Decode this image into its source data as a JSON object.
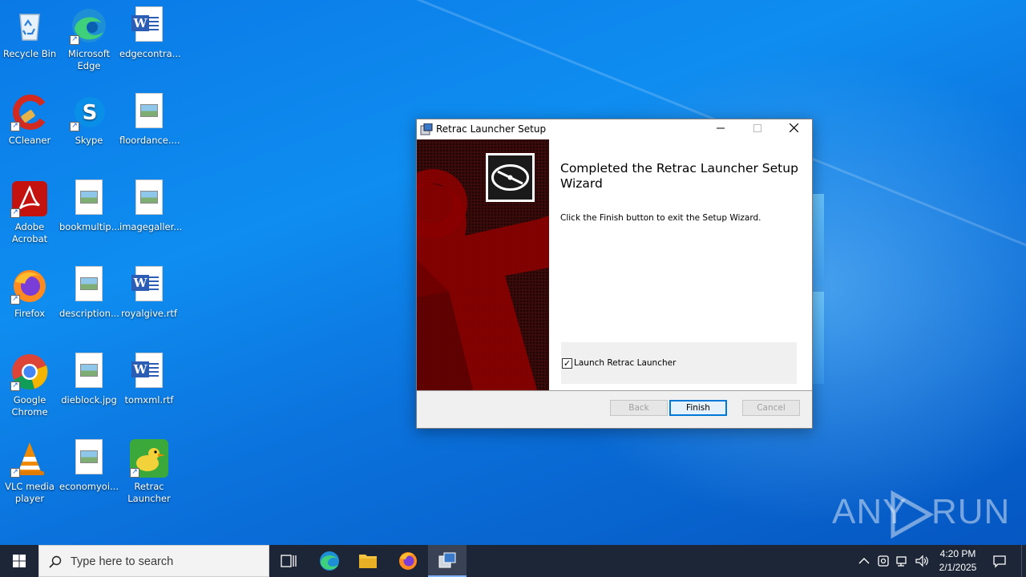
{
  "desktop": {
    "icons": [
      {
        "label": "Recycle Bin",
        "icon": "recycle-bin-icon"
      },
      {
        "label": "Microsoft Edge",
        "icon": "edge-icon"
      },
      {
        "label": "edgecontra...",
        "icon": "word-document-icon"
      },
      {
        "label": "CCleaner",
        "icon": "ccleaner-icon"
      },
      {
        "label": "Skype",
        "icon": "skype-icon"
      },
      {
        "label": "floordance....",
        "icon": "image-file-icon"
      },
      {
        "label": "Adobe Acrobat",
        "icon": "acrobat-icon"
      },
      {
        "label": "bookmultip...",
        "icon": "image-file-icon"
      },
      {
        "label": "imagegaller...",
        "icon": "image-file-icon"
      },
      {
        "label": "Firefox",
        "icon": "firefox-icon"
      },
      {
        "label": "description...",
        "icon": "image-file-icon"
      },
      {
        "label": "royalgive.rtf",
        "icon": "word-document-icon"
      },
      {
        "label": "Google Chrome",
        "icon": "chrome-icon"
      },
      {
        "label": "dieblock.jpg",
        "icon": "image-file-icon"
      },
      {
        "label": "tomxml.rtf",
        "icon": "word-document-icon"
      },
      {
        "label": "VLC media player",
        "icon": "vlc-icon"
      },
      {
        "label": "economyoi...",
        "icon": "image-file-icon"
      },
      {
        "label": "Retrac Launcher",
        "icon": "retrac-launcher-icon"
      }
    ]
  },
  "dialog": {
    "title": "Retrac Launcher Setup",
    "heading": "Completed the Retrac Launcher Setup Wizard",
    "body": "Click the Finish button to exit the Setup Wizard.",
    "checkbox": {
      "label": "Launch Retrac Launcher",
      "checked": true
    },
    "buttons": {
      "back": "Back",
      "finish": "Finish",
      "cancel": "Cancel"
    },
    "banner_colors": {
      "dark": "#3a0a0a",
      "accent": "#8b0000"
    }
  },
  "taskbar": {
    "search_placeholder": "Type here to search",
    "apps": [
      "task-view-icon",
      "edge-icon",
      "file-explorer-icon",
      "firefox-icon",
      "setup-installer-icon"
    ],
    "clock": {
      "time": "4:20 PM",
      "date": "2/1/2025"
    }
  },
  "watermark": {
    "text_left": "ANY",
    "text_right": "RUN"
  }
}
